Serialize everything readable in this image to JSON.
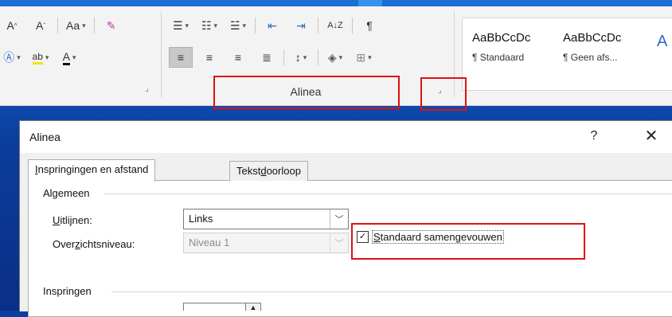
{
  "ribbon": {
    "font_group": {
      "grow_font_icon": "A^",
      "shrink_font_icon": "Aˇ",
      "change_case_label": "Aa",
      "text_effects_icon": "A",
      "highlight_icon": "ab",
      "font_color_icon": "A"
    },
    "paragraph_group": {
      "label": "Alinea",
      "sort_icon": "A↓Z",
      "pilcrow": "¶"
    },
    "styles": [
      {
        "sample": "AaBbCcDc",
        "name": "¶ Standaard"
      },
      {
        "sample": "AaBbCcDc",
        "name": "¶ Geen afs..."
      },
      {
        "sample": "A",
        "name": ""
      }
    ]
  },
  "dialog": {
    "title": "Alinea",
    "help_label": "?",
    "close_label": "✕",
    "tabs": [
      {
        "prefix": "",
        "underlined": "I",
        "rest": "nspringingen en afstand",
        "active": true
      },
      {
        "prefix": "Tekst",
        "underlined": "d",
        "rest": "oorloop",
        "active": false
      }
    ],
    "sections": {
      "general": "Algemeen",
      "indent": "Inspringen"
    },
    "alignment": {
      "label_u": "U",
      "label_rest": "itlijnen:",
      "value": "Links"
    },
    "outline_level": {
      "label_pre": "Over",
      "label_u": "z",
      "label_rest": "ichtsniveau:",
      "value": "Niveau 1",
      "disabled": true
    },
    "collapsed_checkbox": {
      "label_u": "S",
      "label_rest": "tandaard samengevouwen",
      "checked": true,
      "check_glyph": "✓"
    }
  }
}
